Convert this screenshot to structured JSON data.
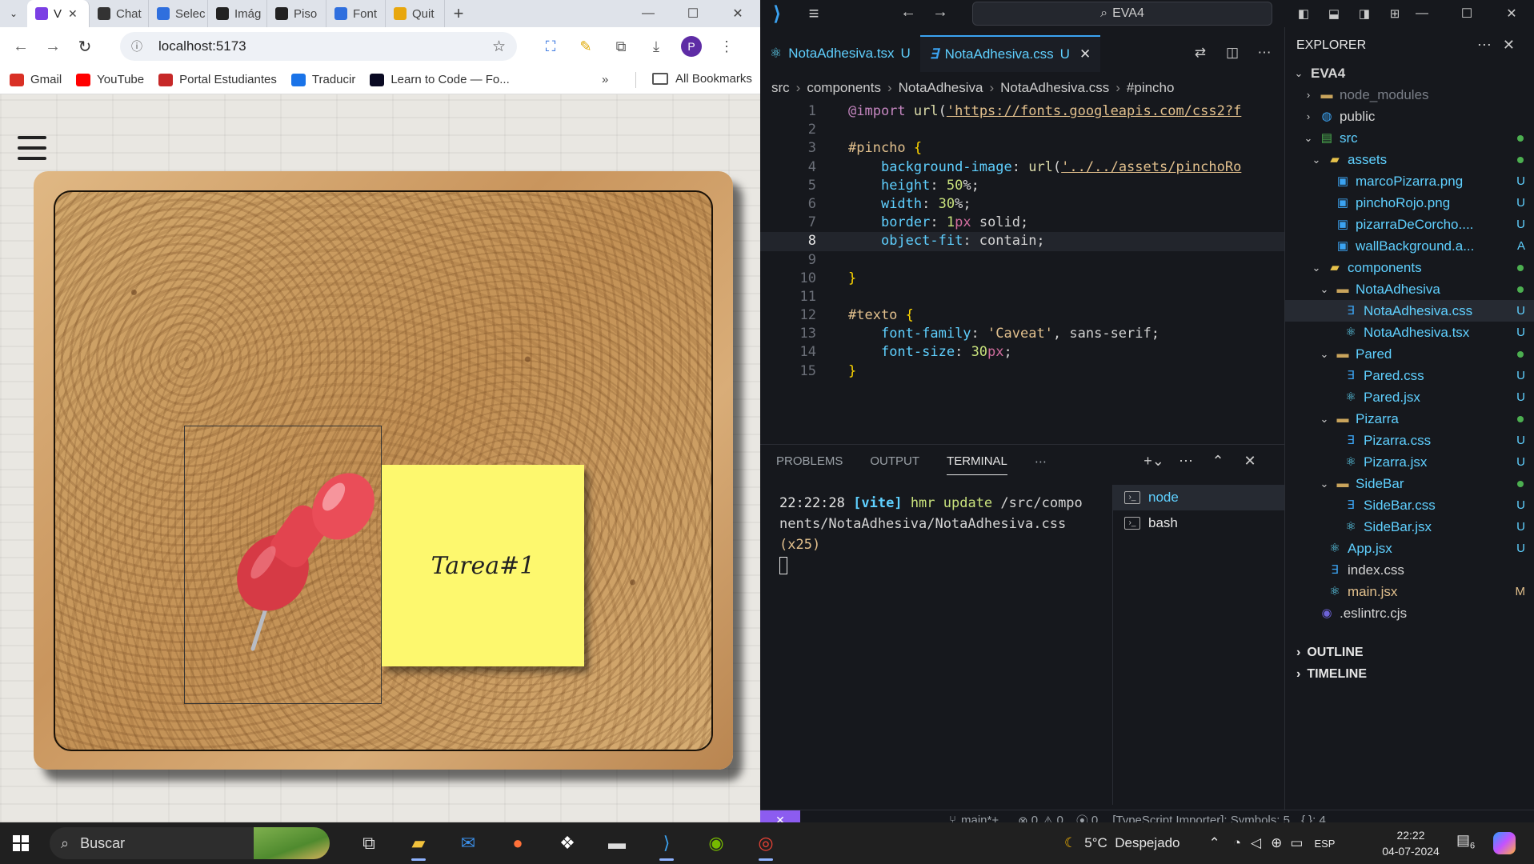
{
  "browser": {
    "tabs": [
      {
        "label": "V",
        "color": "#7b3fe4",
        "active": true
      },
      {
        "label": "Chat",
        "color": "#333333"
      },
      {
        "label": "Selec",
        "color": "#2f6fde"
      },
      {
        "label": "Imág",
        "color": "#222222"
      },
      {
        "label": "Piso",
        "color": "#222222"
      },
      {
        "label": "Font",
        "color": "#2f6fde"
      },
      {
        "label": "Quit",
        "color": "#e8a70d"
      }
    ],
    "url": "localhost:5173",
    "bookmarks": [
      {
        "label": "Gmail",
        "color": "#d93025"
      },
      {
        "label": "YouTube",
        "color": "#ff0000"
      },
      {
        "label": "Portal Estudiantes",
        "color": "#c62828"
      },
      {
        "label": "Traducir",
        "color": "#1a73e8"
      },
      {
        "label": "Learn to Code — Fo...",
        "color": "#0a0a23"
      }
    ],
    "all_bookmarks": "All Bookmarks",
    "profile_initial": "P",
    "page": {
      "sticky_note_text": "Tarea#1"
    }
  },
  "vscode": {
    "search": "EVA4",
    "editor_tabs": [
      {
        "name": "NotaAdhesiva.tsx",
        "status": "U",
        "icon": "react-icon",
        "active": false
      },
      {
        "name": "NotaAdhesiva.css",
        "status": "U",
        "icon": "css-icon",
        "active": true
      }
    ],
    "breadcrumb": [
      "src",
      "components",
      "NotaAdhesiva",
      "NotaAdhesiva.css",
      "#pincho"
    ],
    "code_lines": [
      {
        "n": "1",
        "html": "<span class='t-at'>@import</span> <span class='t-fn'>url</span>(<span class='t-str'>'https://fonts.googleapis.com/css2?f</span>"
      },
      {
        "n": "2",
        "html": ""
      },
      {
        "n": "3",
        "html": "<span class='t-sel'>#pincho</span> <span class='t-brace'>{</span>"
      },
      {
        "n": "4",
        "html": "    <span class='t-prop'>background-image</span>: <span class='t-fn'>url</span>(<span class='t-str'>'../../assets/pinchoRo</span>"
      },
      {
        "n": "5",
        "html": "    <span class='t-prop'>height</span>: <span class='t-num'>50</span>%;"
      },
      {
        "n": "6",
        "html": "    <span class='t-prop'>width</span>: <span class='t-num'>30</span>%;"
      },
      {
        "n": "7",
        "html": "    <span class='t-prop'>border</span>: <span class='t-num'>1</span><span class='t-unit'>px</span> solid;"
      },
      {
        "n": "8",
        "html": "    <span class='t-prop'>object-fit</span>: contain;",
        "current": true
      },
      {
        "n": "9",
        "html": ""
      },
      {
        "n": "10",
        "html": "<span class='t-brace'>}</span>"
      },
      {
        "n": "11",
        "html": ""
      },
      {
        "n": "12",
        "html": "<span class='t-sel'>#texto</span> <span class='t-brace'>{</span>"
      },
      {
        "n": "13",
        "html": "    <span class='t-prop'>font-family</span>: <span class='t-sel'>'Caveat'</span>, sans-serif;"
      },
      {
        "n": "14",
        "html": "    <span class='t-prop'>font-size</span>: <span class='t-num'>30</span><span class='t-unit'>px</span>;"
      },
      {
        "n": "15",
        "html": "<span class='t-brace'>}</span>"
      }
    ],
    "panel_tabs": [
      "PROBLEMS",
      "OUTPUT",
      "TERMINAL"
    ],
    "active_panel_tab": "TERMINAL",
    "terminal": {
      "time": "22:22:28",
      "tag": "[vite]",
      "msg": "hmr update",
      "path": "/src/components/NotaAdhesiva/NotaAdhesiva.css",
      "count": "(x25)"
    },
    "terminals": [
      "node",
      "bash"
    ],
    "explorer": {
      "title": "EXPLORER",
      "root": "EVA4",
      "items": [
        {
          "label": "node_modules",
          "depth": 1,
          "chev": "›",
          "icon": "folder",
          "dim": true
        },
        {
          "label": "public",
          "depth": 1,
          "chev": "›",
          "icon": "folder-globe"
        },
        {
          "label": "src",
          "depth": 1,
          "chev": "⌄",
          "icon": "folder-src",
          "dot": true
        },
        {
          "label": "assets",
          "depth": 2,
          "chev": "⌄",
          "icon": "folder-yellow",
          "dot": true
        },
        {
          "label": "marcoPizarra.png",
          "depth": 3,
          "icon": "image",
          "status": "U"
        },
        {
          "label": "pinchoRojo.png",
          "depth": 3,
          "icon": "image",
          "status": "U"
        },
        {
          "label": "pizarraDeCorcho....",
          "depth": 3,
          "icon": "image",
          "status": "U"
        },
        {
          "label": "wallBackground.a...",
          "depth": 3,
          "icon": "image",
          "status": "A"
        },
        {
          "label": "components",
          "depth": 2,
          "chev": "⌄",
          "icon": "folder-yellow",
          "dot": true
        },
        {
          "label": "NotaAdhesiva",
          "depth": 3,
          "chev": "⌄",
          "icon": "folder",
          "dot": true
        },
        {
          "label": "NotaAdhesiva.css",
          "depth": 4,
          "icon": "css",
          "status": "U",
          "selected": true
        },
        {
          "label": "NotaAdhesiva.tsx",
          "depth": 4,
          "icon": "react",
          "status": "U"
        },
        {
          "label": "Pared",
          "depth": 3,
          "chev": "⌄",
          "icon": "folder",
          "dot": true
        },
        {
          "label": "Pared.css",
          "depth": 4,
          "icon": "css",
          "status": "U"
        },
        {
          "label": "Pared.jsx",
          "depth": 4,
          "icon": "react",
          "status": "U"
        },
        {
          "label": "Pizarra",
          "depth": 3,
          "chev": "⌄",
          "icon": "folder",
          "dot": true
        },
        {
          "label": "Pizarra.css",
          "depth": 4,
          "icon": "css",
          "status": "U"
        },
        {
          "label": "Pizarra.jsx",
          "depth": 4,
          "icon": "react",
          "status": "U"
        },
        {
          "label": "SideBar",
          "depth": 3,
          "chev": "⌄",
          "icon": "folder",
          "dot": true
        },
        {
          "label": "SideBar.css",
          "depth": 4,
          "icon": "css",
          "status": "U"
        },
        {
          "label": "SideBar.jsx",
          "depth": 4,
          "icon": "react",
          "status": "U"
        },
        {
          "label": "App.jsx",
          "depth": 2,
          "icon": "react",
          "status": "U"
        },
        {
          "label": "index.css",
          "depth": 2,
          "icon": "css"
        },
        {
          "label": "main.jsx",
          "depth": 2,
          "icon": "react",
          "status": "M"
        },
        {
          "label": ".eslintrc.cjs",
          "depth": 1,
          "icon": "eslint"
        }
      ],
      "outline": "OUTLINE",
      "timeline": "TIMELINE"
    },
    "status": {
      "branch": "main*+",
      "errors": "0",
      "warnings": "0",
      "ports": "0",
      "ts": "[TypeScript Importer]: Symbols: 5",
      "braces": "{.}: 4"
    }
  },
  "taskbar": {
    "search": "Buscar",
    "weather": "5°C  Despejado",
    "lang": "ESP",
    "time": "22:22",
    "date": "04-07-2024",
    "notifications": "6"
  }
}
